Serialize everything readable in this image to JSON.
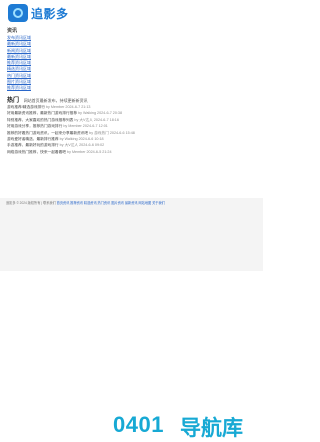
{
  "header": {
    "logo_text": "追影多"
  },
  "nav": {
    "title": "资讯",
    "items": [
      "发布资讯区域",
      "最新资讯区域",
      "新闻资讯区域",
      "最新资讯区域",
      "推荐资讯区域",
      "精选资讯区域",
      "热门资讯区域",
      "图片资讯区域",
      "推荐资讯区域"
    ]
  },
  "section": {
    "title": "热门",
    "subtitle": "网站首页最新发布，持续更新新资讯"
  },
  "items": [
    {
      "title": "游戏推荐/精选游戏排行",
      "meta": "by Member 2024-6-7 21:13"
    },
    {
      "title": "好用最新资讯推荐，最新热门游戏排行推荐",
      "meta": "by Walking 2024-6-7 20:38"
    },
    {
      "title": "特别推荐，大家喜欢的热门游戏推荐列表",
      "meta": "by 大V达人 2024-6-7 18:16"
    },
    {
      "title": "好用游戏分享，推荐热门游戏排行",
      "meta": "by Member 2024-6-7 12:01"
    },
    {
      "title": "推荐的好看热门游戏资讯，一起来分享最新资讯吧",
      "meta": "by 游戏热门 2024-6-6 15:48"
    },
    {
      "title": "游戏爱好者精选，最新排行推荐",
      "meta": "by Walking 2024-6-6 10:18"
    },
    {
      "title": "手游推荐，最新好玩的游戏排行",
      "meta": "by 大V达人 2024-6-6 09:02"
    },
    {
      "title": "网络游戏热门推荐，快来一起看看吧",
      "meta": "by Member 2024-6-5 21:24"
    }
  ],
  "footer": {
    "copyright": "追影多 © 2024 版权所有 | 联系我们",
    "links": "首页资讯 推荐资讯 精选资讯 热门资讯 图片资讯 最新资讯 网站地图 关于我们"
  },
  "error": {
    "code": "0401",
    "text": "导航库"
  },
  "colors": {
    "accent": "#1e7bd4",
    "link": "#2a67c9",
    "big_text": "#17a9d4"
  }
}
